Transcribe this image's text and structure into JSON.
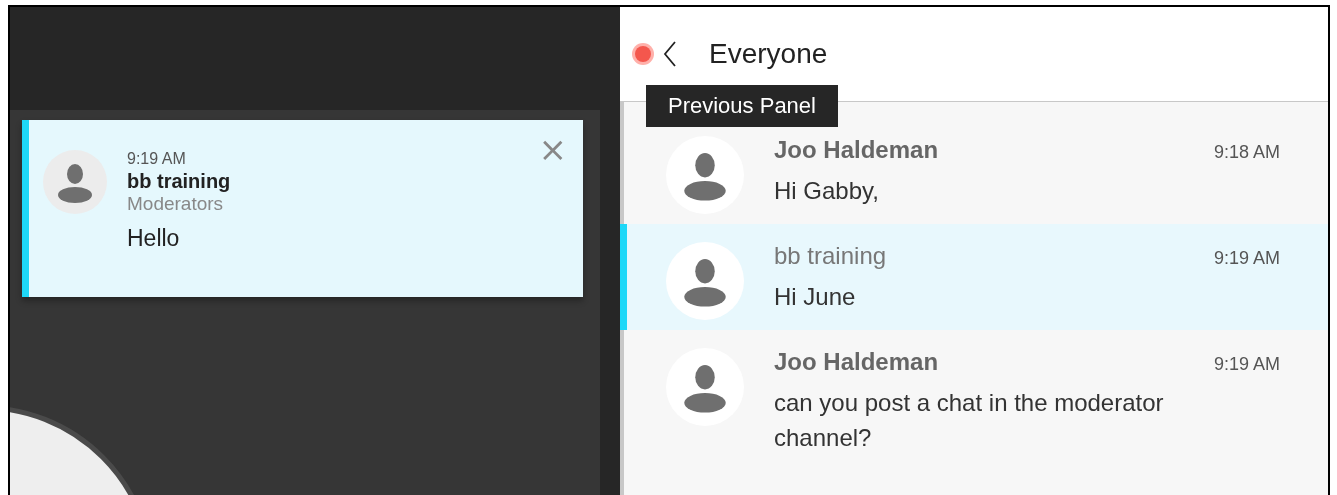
{
  "notification": {
    "time": "9:19 AM",
    "sender": "bb training",
    "channel": "Moderators",
    "message": "Hello",
    "close": "×"
  },
  "chat_panel": {
    "title": "Everyone",
    "tooltip": "Previous Panel",
    "messages": [
      {
        "sender": "Joo Haldeman",
        "kind": "other",
        "time": "9:18 AM",
        "text": "Hi Gabby,",
        "selected": false
      },
      {
        "sender": "bb training",
        "kind": "own",
        "time": "9:19 AM",
        "text": "Hi June",
        "selected": true
      },
      {
        "sender": "Joo Haldeman",
        "kind": "other",
        "time": "9:19 AM",
        "text": "can you post a chat in the moderator channel?",
        "selected": false
      }
    ]
  }
}
